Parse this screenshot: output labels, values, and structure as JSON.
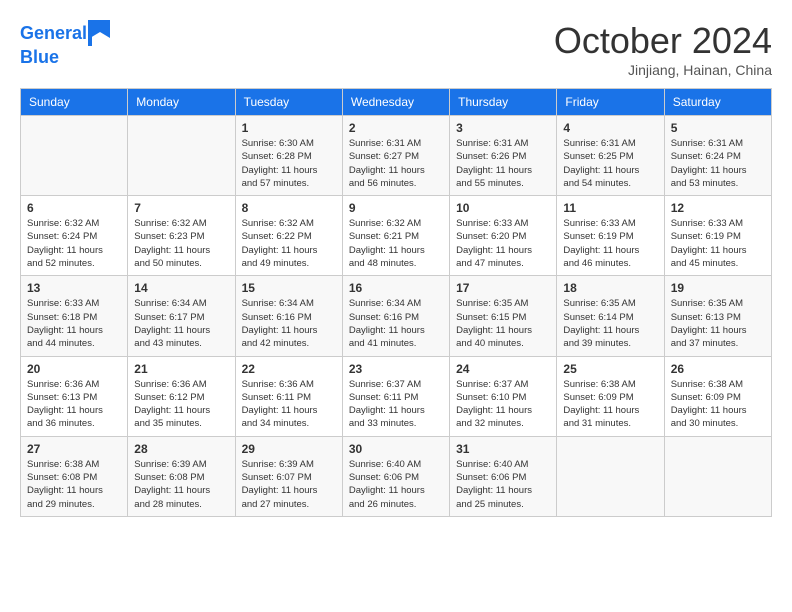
{
  "header": {
    "logo_line1": "General",
    "logo_line2": "Blue",
    "month": "October 2024",
    "location": "Jinjiang, Hainan, China"
  },
  "days_of_week": [
    "Sunday",
    "Monday",
    "Tuesday",
    "Wednesday",
    "Thursday",
    "Friday",
    "Saturday"
  ],
  "weeks": [
    [
      {
        "day": "",
        "info": ""
      },
      {
        "day": "",
        "info": ""
      },
      {
        "day": "1",
        "info": "Sunrise: 6:30 AM\nSunset: 6:28 PM\nDaylight: 11 hours and 57 minutes."
      },
      {
        "day": "2",
        "info": "Sunrise: 6:31 AM\nSunset: 6:27 PM\nDaylight: 11 hours and 56 minutes."
      },
      {
        "day": "3",
        "info": "Sunrise: 6:31 AM\nSunset: 6:26 PM\nDaylight: 11 hours and 55 minutes."
      },
      {
        "day": "4",
        "info": "Sunrise: 6:31 AM\nSunset: 6:25 PM\nDaylight: 11 hours and 54 minutes."
      },
      {
        "day": "5",
        "info": "Sunrise: 6:31 AM\nSunset: 6:24 PM\nDaylight: 11 hours and 53 minutes."
      }
    ],
    [
      {
        "day": "6",
        "info": "Sunrise: 6:32 AM\nSunset: 6:24 PM\nDaylight: 11 hours and 52 minutes."
      },
      {
        "day": "7",
        "info": "Sunrise: 6:32 AM\nSunset: 6:23 PM\nDaylight: 11 hours and 50 minutes."
      },
      {
        "day": "8",
        "info": "Sunrise: 6:32 AM\nSunset: 6:22 PM\nDaylight: 11 hours and 49 minutes."
      },
      {
        "day": "9",
        "info": "Sunrise: 6:32 AM\nSunset: 6:21 PM\nDaylight: 11 hours and 48 minutes."
      },
      {
        "day": "10",
        "info": "Sunrise: 6:33 AM\nSunset: 6:20 PM\nDaylight: 11 hours and 47 minutes."
      },
      {
        "day": "11",
        "info": "Sunrise: 6:33 AM\nSunset: 6:19 PM\nDaylight: 11 hours and 46 minutes."
      },
      {
        "day": "12",
        "info": "Sunrise: 6:33 AM\nSunset: 6:19 PM\nDaylight: 11 hours and 45 minutes."
      }
    ],
    [
      {
        "day": "13",
        "info": "Sunrise: 6:33 AM\nSunset: 6:18 PM\nDaylight: 11 hours and 44 minutes."
      },
      {
        "day": "14",
        "info": "Sunrise: 6:34 AM\nSunset: 6:17 PM\nDaylight: 11 hours and 43 minutes."
      },
      {
        "day": "15",
        "info": "Sunrise: 6:34 AM\nSunset: 6:16 PM\nDaylight: 11 hours and 42 minutes."
      },
      {
        "day": "16",
        "info": "Sunrise: 6:34 AM\nSunset: 6:16 PM\nDaylight: 11 hours and 41 minutes."
      },
      {
        "day": "17",
        "info": "Sunrise: 6:35 AM\nSunset: 6:15 PM\nDaylight: 11 hours and 40 minutes."
      },
      {
        "day": "18",
        "info": "Sunrise: 6:35 AM\nSunset: 6:14 PM\nDaylight: 11 hours and 39 minutes."
      },
      {
        "day": "19",
        "info": "Sunrise: 6:35 AM\nSunset: 6:13 PM\nDaylight: 11 hours and 37 minutes."
      }
    ],
    [
      {
        "day": "20",
        "info": "Sunrise: 6:36 AM\nSunset: 6:13 PM\nDaylight: 11 hours and 36 minutes."
      },
      {
        "day": "21",
        "info": "Sunrise: 6:36 AM\nSunset: 6:12 PM\nDaylight: 11 hours and 35 minutes."
      },
      {
        "day": "22",
        "info": "Sunrise: 6:36 AM\nSunset: 6:11 PM\nDaylight: 11 hours and 34 minutes."
      },
      {
        "day": "23",
        "info": "Sunrise: 6:37 AM\nSunset: 6:11 PM\nDaylight: 11 hours and 33 minutes."
      },
      {
        "day": "24",
        "info": "Sunrise: 6:37 AM\nSunset: 6:10 PM\nDaylight: 11 hours and 32 minutes."
      },
      {
        "day": "25",
        "info": "Sunrise: 6:38 AM\nSunset: 6:09 PM\nDaylight: 11 hours and 31 minutes."
      },
      {
        "day": "26",
        "info": "Sunrise: 6:38 AM\nSunset: 6:09 PM\nDaylight: 11 hours and 30 minutes."
      }
    ],
    [
      {
        "day": "27",
        "info": "Sunrise: 6:38 AM\nSunset: 6:08 PM\nDaylight: 11 hours and 29 minutes."
      },
      {
        "day": "28",
        "info": "Sunrise: 6:39 AM\nSunset: 6:08 PM\nDaylight: 11 hours and 28 minutes."
      },
      {
        "day": "29",
        "info": "Sunrise: 6:39 AM\nSunset: 6:07 PM\nDaylight: 11 hours and 27 minutes."
      },
      {
        "day": "30",
        "info": "Sunrise: 6:40 AM\nSunset: 6:06 PM\nDaylight: 11 hours and 26 minutes."
      },
      {
        "day": "31",
        "info": "Sunrise: 6:40 AM\nSunset: 6:06 PM\nDaylight: 11 hours and 25 minutes."
      },
      {
        "day": "",
        "info": ""
      },
      {
        "day": "",
        "info": ""
      }
    ]
  ]
}
